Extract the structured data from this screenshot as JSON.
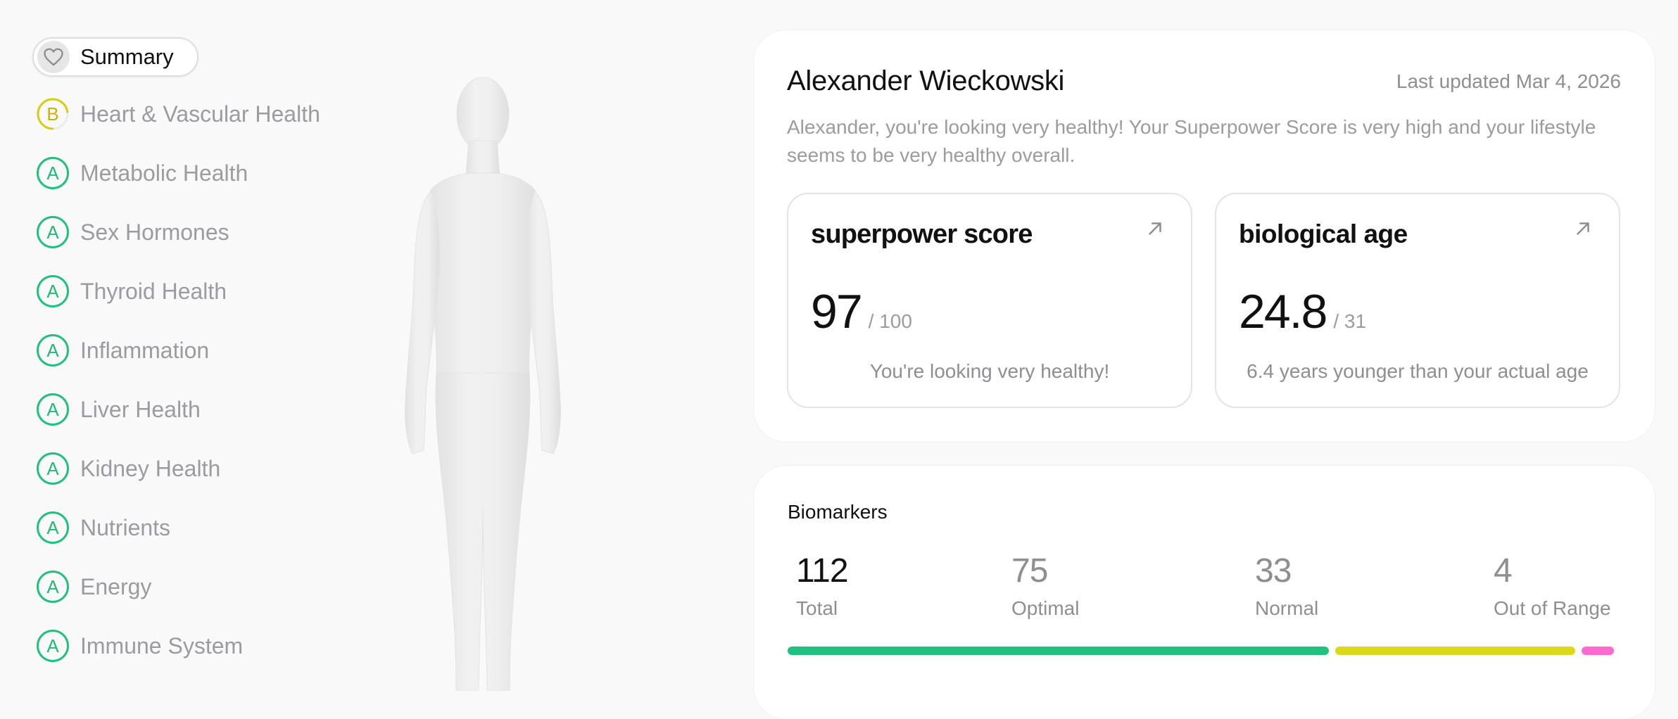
{
  "sidebar": {
    "summary_label": "Summary",
    "categories": [
      {
        "grade": "B",
        "label": "Heart & Vascular Health"
      },
      {
        "grade": "A",
        "label": "Metabolic Health"
      },
      {
        "grade": "A",
        "label": "Sex Hormones"
      },
      {
        "grade": "A",
        "label": "Thyroid Health"
      },
      {
        "grade": "A",
        "label": "Inflammation"
      },
      {
        "grade": "A",
        "label": "Liver Health"
      },
      {
        "grade": "A",
        "label": "Kidney Health"
      },
      {
        "grade": "A",
        "label": "Nutrients"
      },
      {
        "grade": "A",
        "label": "Energy"
      },
      {
        "grade": "A",
        "label": "Immune System"
      }
    ]
  },
  "profile": {
    "name": "Alexander Wieckowski",
    "last_updated": "Last updated Mar 4, 2026",
    "description": "Alexander, you're looking very healthy! Your Superpower Score is very high and your lifestyle seems to be very healthy overall."
  },
  "superpower_score": {
    "title": "superpower score",
    "value": "97",
    "max": "/ 100",
    "subtitle": "You're looking very healthy!"
  },
  "biological_age": {
    "title": "biological age",
    "value": "24.8",
    "max": "/ 31",
    "subtitle": "6.4 years younger than your actual age"
  },
  "biomarkers": {
    "title": "Biomarkers",
    "stats": [
      {
        "value": "112",
        "label": "Total"
      },
      {
        "value": "75",
        "label": "Optimal"
      },
      {
        "value": "33",
        "label": "Normal"
      },
      {
        "value": "4",
        "label": "Out of Range"
      }
    ]
  },
  "colors": {
    "grade_a": "#22c07f",
    "grade_b": "#d9cc14",
    "optimal": "#20c17e",
    "normal": "#dcd91a",
    "out_of_range": "#ff6ad0"
  }
}
